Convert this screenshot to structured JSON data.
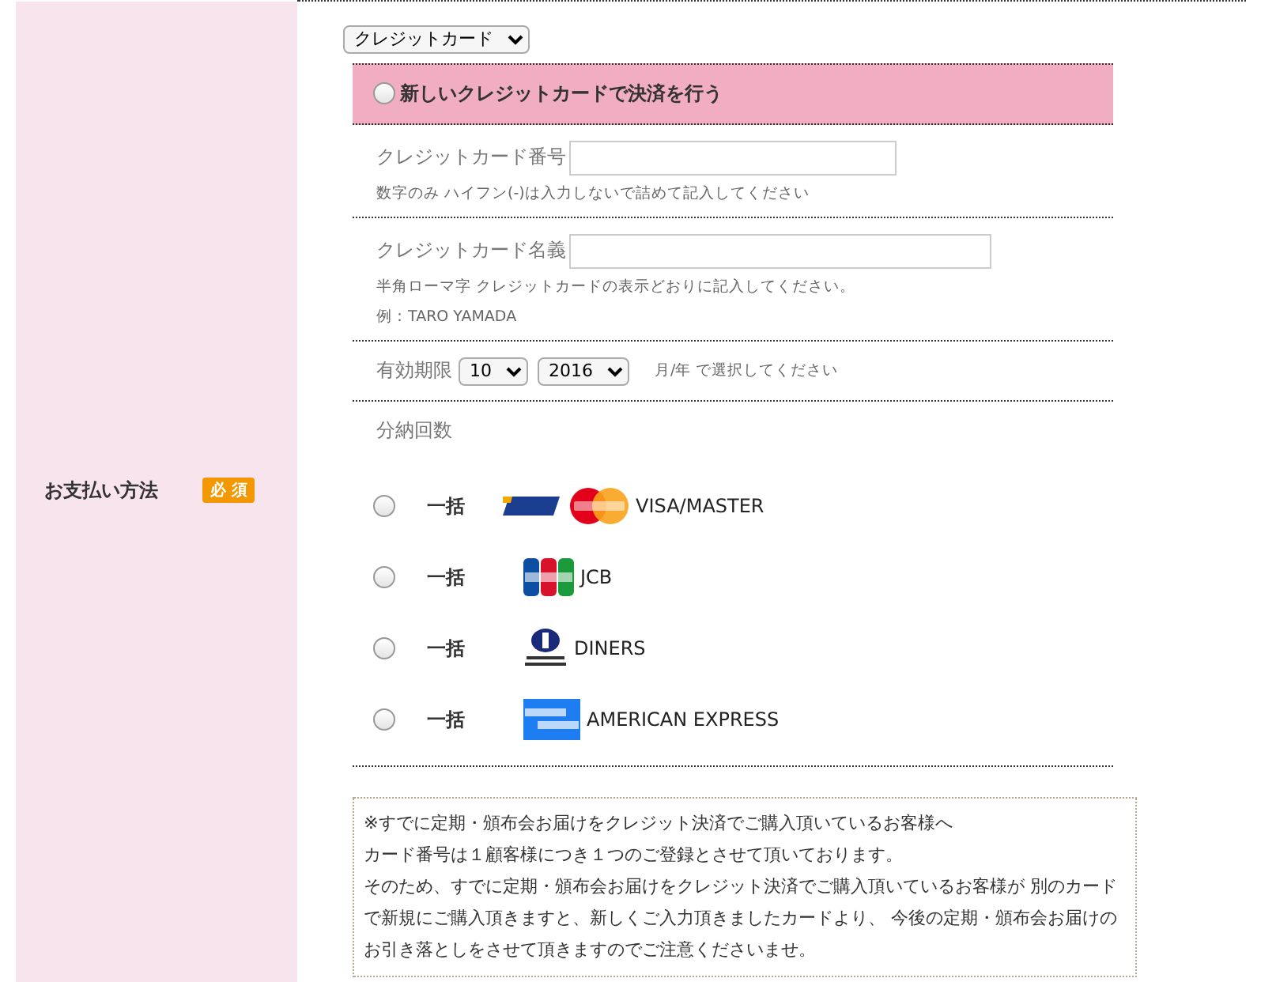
{
  "row_label": "お支払い方法",
  "required_badge": "必 須",
  "method_select": {
    "value": "クレジットカード"
  },
  "new_card": {
    "label": "新しいクレジットカードで決済を行う",
    "selected": false
  },
  "card_number": {
    "label": "クレジットカード番号",
    "hint": "数字のみ ハイフン(-)は入力しないで詰めて記入してください"
  },
  "card_name": {
    "label": "クレジットカード名義",
    "hint": "半角ローマ字 クレジットカードの表示どおりに記入してください。",
    "example": "例：TARO YAMADA"
  },
  "expiry": {
    "label": "有効期限",
    "month": "10",
    "year": "2016",
    "hint": "月/年 で選択してください"
  },
  "installments": {
    "label": "分納回数",
    "options": [
      {
        "kind": "visa_master",
        "payment": "一括",
        "brand": "VISA/MASTER",
        "selected": false
      },
      {
        "kind": "jcb",
        "payment": "一括",
        "brand": "JCB",
        "selected": false
      },
      {
        "kind": "diners",
        "payment": "一括",
        "brand": "DINERS",
        "selected": false
      },
      {
        "kind": "amex",
        "payment": "一括",
        "brand": "AMERICAN EXPRESS",
        "selected": false
      }
    ]
  },
  "notice": [
    "※すでに定期・頒布会お届けをクレジット決済でご購入頂いているお客様へ",
    "カード番号は１顧客様につき１つのご登録とさせて頂いております。",
    "そのため、すでに定期・頒布会お届けをクレジット決済でご購入頂いているお客様が 別のカードで新規にご購入頂きますと、新しくご入力頂きましたカードより、 今後の定期・頒布会お届けのお引き落としをさせて頂きますのでご注意くださいませ。"
  ]
}
